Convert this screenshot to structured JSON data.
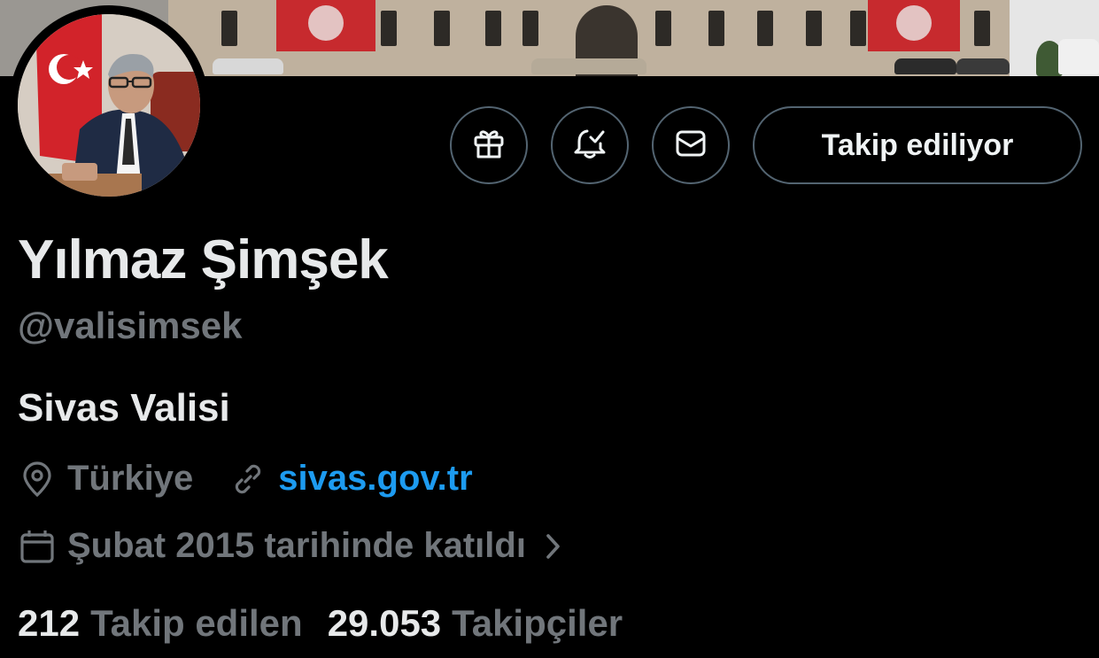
{
  "profile": {
    "display_name": "Yılmaz Şimşek",
    "handle": "@valisimsek",
    "bio": "Sivas Valisi",
    "location": "Türkiye",
    "website": "sivas.gov.tr",
    "joined": "Şubat 2015 tarihinde katıldı"
  },
  "actions": {
    "follow_label": "Takip ediliyor",
    "icons": [
      "gift-icon",
      "bell-check-icon",
      "mail-icon"
    ]
  },
  "stats": {
    "following_count": "212",
    "following_label": "Takip edilen",
    "followers_count": "29.053",
    "followers_label": "Takipçiler"
  },
  "colors": {
    "background": "#000000",
    "text": "#e7e9ea",
    "muted": "#71767b",
    "link": "#1d9bf0",
    "border": "#536471"
  }
}
